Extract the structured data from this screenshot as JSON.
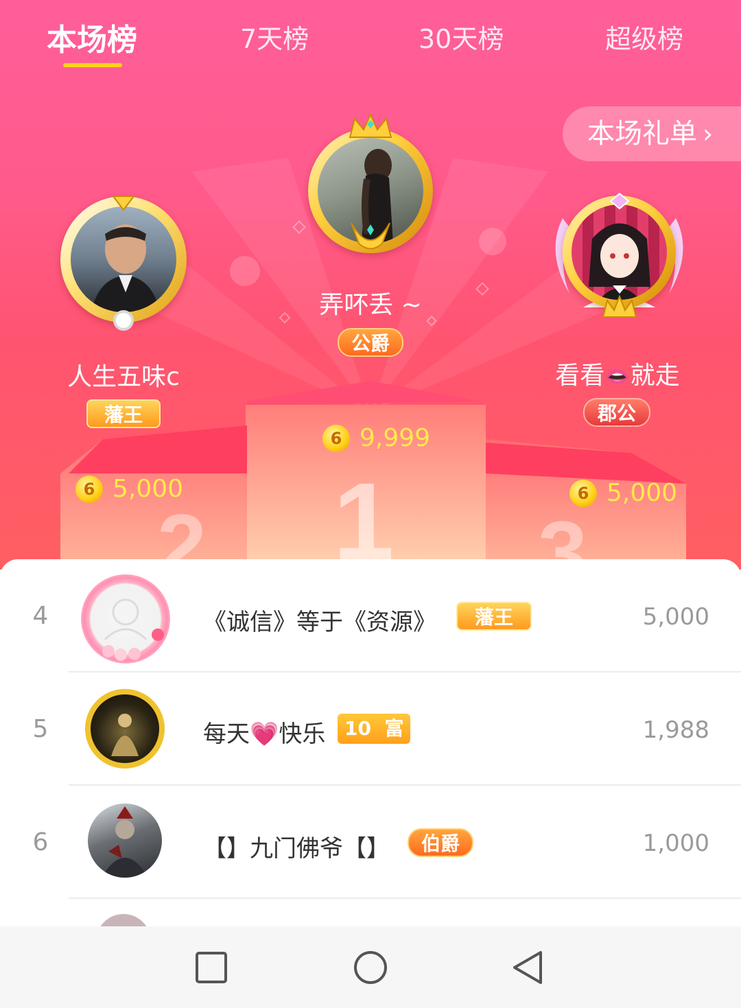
{
  "tabs": [
    {
      "label": "本场榜",
      "active": true
    },
    {
      "label": "7天榜",
      "active": false
    },
    {
      "label": "30天榜",
      "active": false
    },
    {
      "label": "超级榜",
      "active": false
    }
  ],
  "gift_list_button": {
    "label": "本场礼单",
    "icon": "chevron-right-icon"
  },
  "podium": {
    "first": {
      "name": "弄吥丢 ~",
      "badge": "公爵",
      "coins": "9,999",
      "place": "1"
    },
    "second": {
      "name": "人生五味c",
      "badge": "藩王",
      "coins": "5,000",
      "place": "2"
    },
    "third": {
      "name": "看看",
      "name_emoji": "👄",
      "name_suffix": "就走",
      "badge": "郡公",
      "coins": "5,000",
      "place": "3"
    }
  },
  "coin_icon_label": "6",
  "rankings": [
    {
      "rank": "4",
      "name": "《诚信》等于《资源》",
      "badge": "藩王",
      "value": "5,000"
    },
    {
      "rank": "5",
      "name_prefix": "每天",
      "name_emoji": "💗",
      "name_suffix": "快乐",
      "badge_level": "10",
      "badge": "富",
      "value": "1,988"
    },
    {
      "rank": "6",
      "name": "【】九门佛爷【】",
      "badge": "伯爵",
      "value": "1,000"
    }
  ],
  "colors": {
    "accent_pink": "#ff5a8a",
    "underline_yellow": "#ffd21a",
    "coin_text": "#ffe94a"
  }
}
